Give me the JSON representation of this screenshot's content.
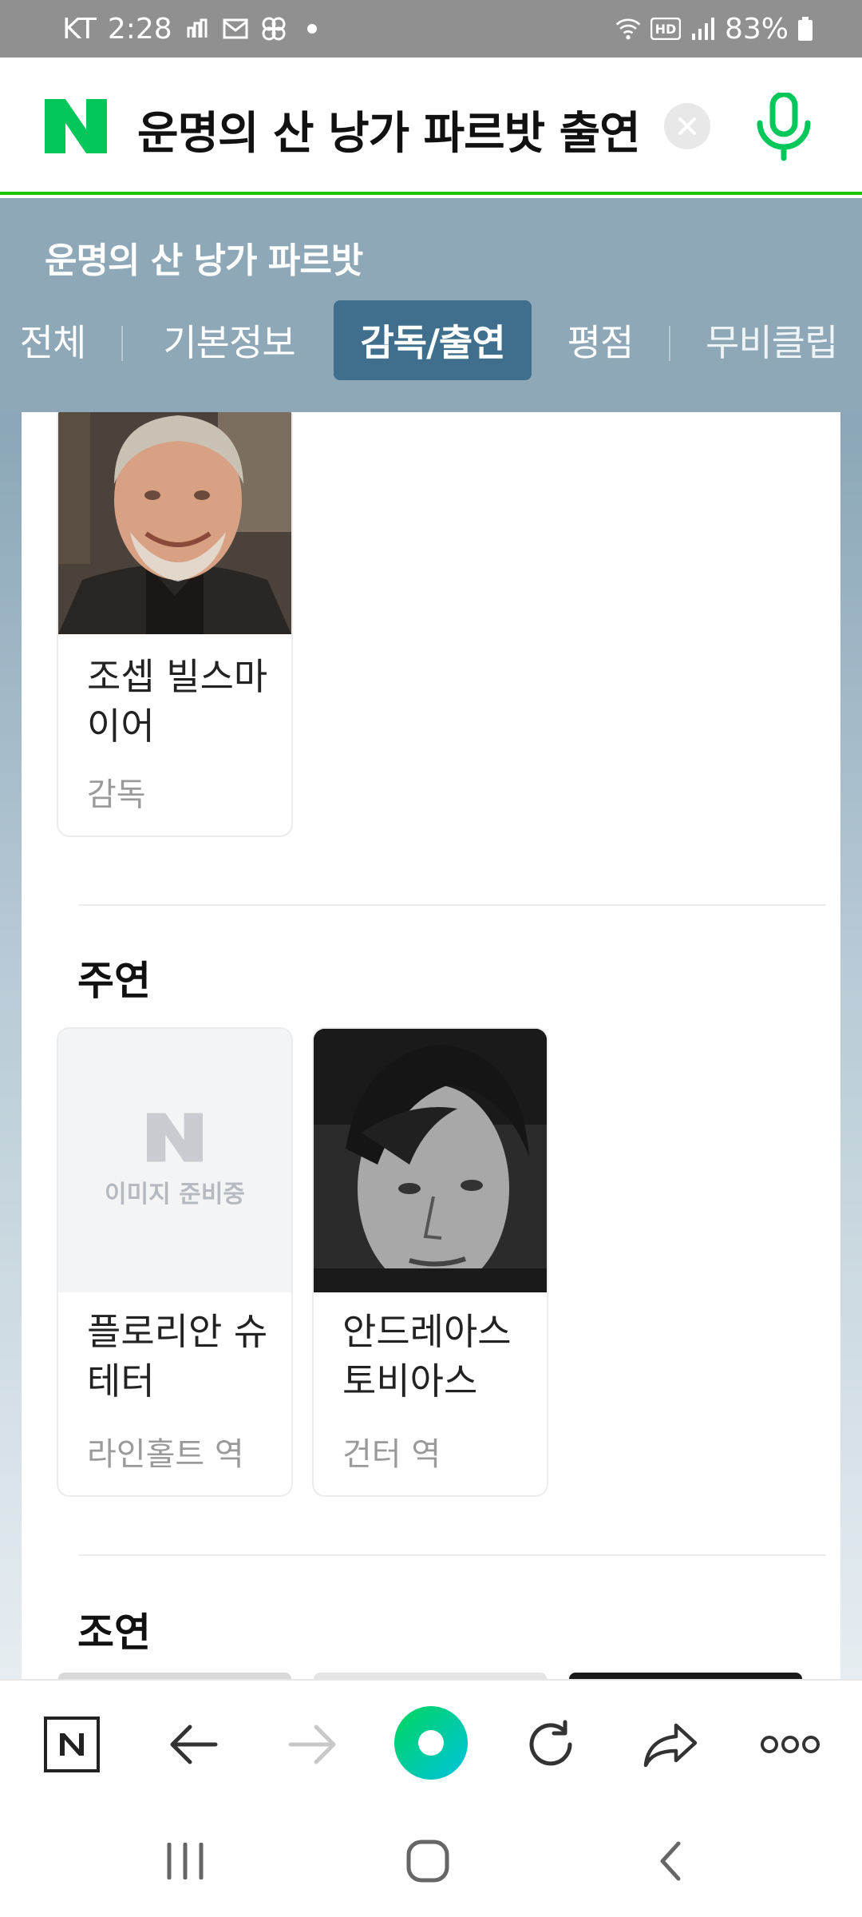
{
  "status_bar": {
    "carrier": "KT",
    "time": "2:28",
    "battery": "83%",
    "icons": [
      "carrier-icon",
      "mail-icon",
      "pinwheel-icon",
      "dot-icon",
      "wifi-icon",
      "hd-icon",
      "signal-icon",
      "battery-icon"
    ]
  },
  "search": {
    "query": "운명의 산 낭가 파르밧 출연",
    "logo_letter": "N"
  },
  "sticky": {
    "title": "운명의 산 낭가 파르밧",
    "tabs": [
      {
        "label": "전체"
      },
      {
        "label": "기본정보"
      },
      {
        "label": "감독/출연"
      },
      {
        "label": "평점"
      },
      {
        "label": "무비클립"
      }
    ]
  },
  "director": {
    "name": "조셉 빌스마이어",
    "role": "감독"
  },
  "lead": {
    "title": "주연",
    "cast": [
      {
        "name": "플로리안 슈테터",
        "role": "라인홀트 역",
        "placeholder_text": "이미지 준비중"
      },
      {
        "name": "안드레아스 토비아스",
        "role": "건터 역"
      }
    ]
  },
  "supporting": {
    "title": "조연"
  },
  "colors": {
    "naver_green": "#03c75a",
    "sticky_bg": "#8fa8b8",
    "active_tab": "#3f6f8c"
  }
}
